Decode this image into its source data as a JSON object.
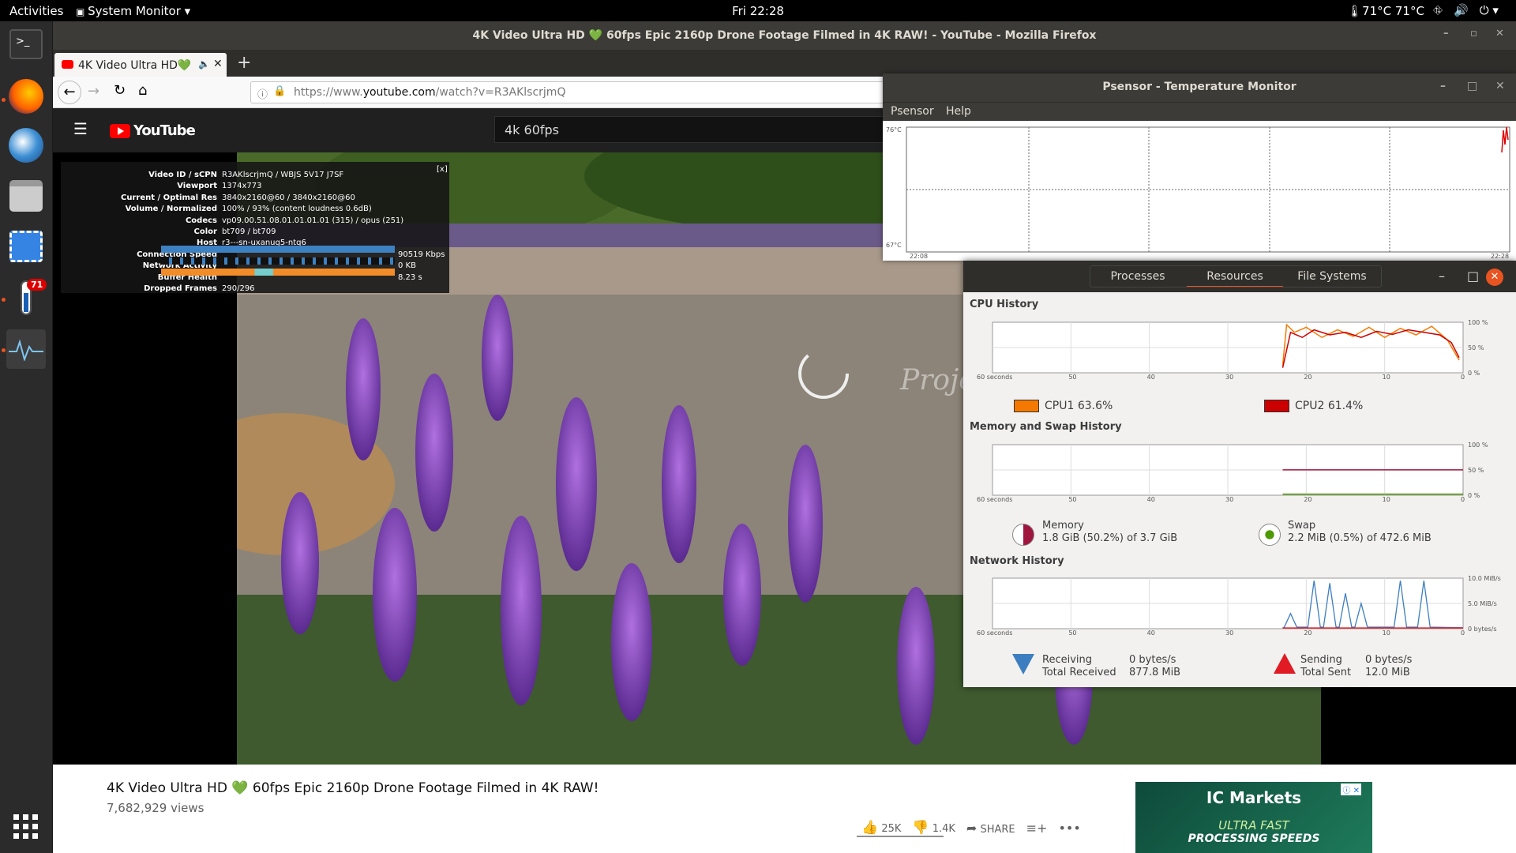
{
  "topbar": {
    "activities": "Activities",
    "app_menu": "System Monitor",
    "clock": "Fri 22:28",
    "temperature": "71°C 71°C"
  },
  "dock": {
    "badge": "71"
  },
  "firefox": {
    "window_title": "4K Video Ultra HD 💚 60fps Epic 2160p Drone Footage Filmed in 4K RAW! - YouTube - Mozilla Firefox",
    "tab_label": "4K Video Ultra HD💚",
    "url_prefix": "https://www.",
    "url_domain": "youtube.com",
    "url_path": "/watch?v=R3AKlscrjmQ"
  },
  "youtube": {
    "logo": "YouTube",
    "search_value": "4k 60fps",
    "stats": [
      {
        "k": "Video ID / sCPN",
        "v": "R3AKlscrjmQ / WBJS 5V17 J7SF"
      },
      {
        "k": "Viewport",
        "v": "1374x773"
      },
      {
        "k": "Current / Optimal Res",
        "v": "3840x2160@60 / 3840x2160@60"
      },
      {
        "k": "Volume / Normalized",
        "v": "100% / 93% (content loudness 0.6dB)"
      },
      {
        "k": "Codecs",
        "v": "vp09.00.51.08.01.01.01.01 (315) / opus (251)"
      },
      {
        "k": "Color",
        "v": "bt709 / bt709"
      },
      {
        "k": "Host",
        "v": "r3---sn-uxanug5-ntq6"
      },
      {
        "k": "Connection Speed",
        "v": "90519 Kbps"
      },
      {
        "k": "Network Activity",
        "v": "0 KB"
      },
      {
        "k": "Buffer Health",
        "v": "8.23 s"
      },
      {
        "k": "Dropped Frames",
        "v": "290/296"
      }
    ],
    "stats_close": "[x]",
    "watermark": "Project o",
    "video_title": "4K Video Ultra HD 💚 60fps Epic 2160p Drone Footage Filmed in 4K RAW!",
    "views": "7,682,929 views",
    "likes": "25K",
    "dislikes": "1.4K",
    "share": "SHARE",
    "ad_brand": "IC Markets",
    "ad_line1": "ULTRA FAST",
    "ad_line2": "PROCESSING SPEEDS"
  },
  "psensor": {
    "title": "Psensor - Temperature Monitor",
    "menu": [
      "Psensor",
      "Help"
    ],
    "y_top": "76°C",
    "y_bottom": "67°C",
    "t_start": "22:08",
    "t_end": "22:28"
  },
  "sysmon": {
    "tabs": [
      "Processes",
      "Resources",
      "File Systems"
    ],
    "active_tab": 1,
    "cpu": {
      "title": "CPU History",
      "cpu1": "CPU1  63.6%",
      "cpu2": "CPU2  61.4%",
      "color1": "#f57900",
      "color2": "#cc0000"
    },
    "mem": {
      "title": "Memory and Swap History",
      "mem_label": "Memory",
      "mem_value": "1.8 GiB (50.2%) of 3.7 GiB",
      "swap_label": "Swap",
      "swap_value": "2.2 MiB (0.5%) of 472.6 MiB"
    },
    "net": {
      "title": "Network History",
      "recv_label": "Receiving",
      "recv_total_label": "Total Received",
      "recv_rate": "0 bytes/s",
      "recv_total": "877.8 MiB",
      "send_label": "Sending",
      "send_total_label": "Total Sent",
      "send_rate": "0 bytes/s",
      "send_total": "12.0 MiB"
    },
    "x_ticks": [
      "60 seconds",
      "50",
      "40",
      "30",
      "20",
      "10",
      "0"
    ],
    "pct_ticks": [
      "100 %",
      "50 %",
      "0 %"
    ],
    "net_ticks": [
      "10.0 MiB/s",
      "5.0 MiB/s",
      "0 bytes/s"
    ]
  },
  "chart_data": [
    {
      "type": "line",
      "title": "CPU History",
      "x": [
        60,
        50,
        40,
        30,
        20,
        10,
        0
      ],
      "ylim": [
        0,
        100
      ],
      "series": [
        {
          "name": "CPU1",
          "values": [
            null,
            null,
            null,
            null,
            90,
            85,
            20
          ]
        },
        {
          "name": "CPU2",
          "values": [
            null,
            null,
            null,
            null,
            80,
            75,
            25
          ]
        }
      ]
    },
    {
      "type": "line",
      "title": "Memory and Swap History",
      "ylim": [
        0,
        100
      ],
      "series": [
        {
          "name": "Memory",
          "values": [
            50.2
          ]
        },
        {
          "name": "Swap",
          "values": [
            0.5
          ]
        }
      ]
    },
    {
      "type": "line",
      "title": "Network History",
      "series": [
        {
          "name": "Receiving",
          "values": [
            0
          ]
        },
        {
          "name": "Sending",
          "values": [
            0
          ]
        }
      ]
    }
  ]
}
